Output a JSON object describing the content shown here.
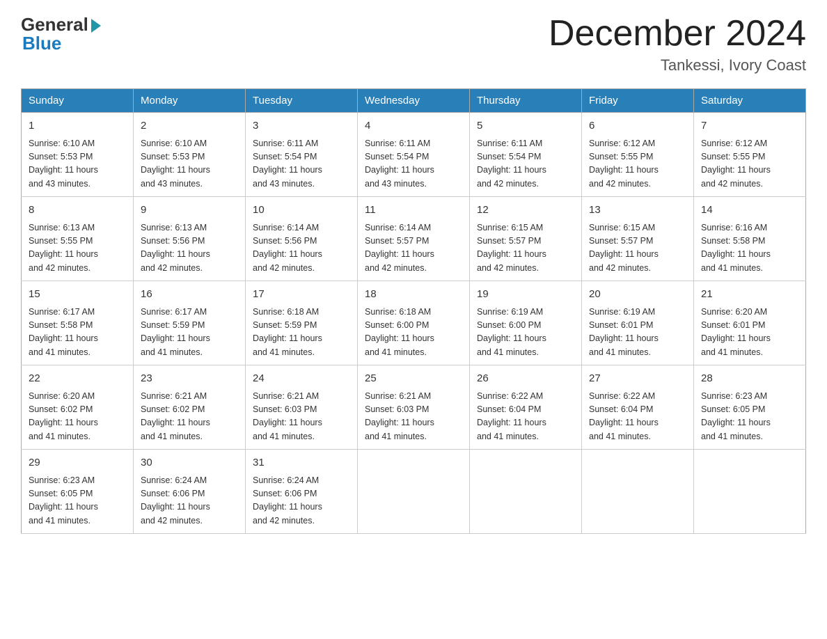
{
  "header": {
    "logo_general": "General",
    "logo_blue": "Blue",
    "month_title": "December 2024",
    "location": "Tankessi, Ivory Coast"
  },
  "days_of_week": [
    "Sunday",
    "Monday",
    "Tuesday",
    "Wednesday",
    "Thursday",
    "Friday",
    "Saturday"
  ],
  "weeks": [
    [
      {
        "day": "1",
        "sunrise": "6:10 AM",
        "sunset": "5:53 PM",
        "daylight": "11 hours and 43 minutes."
      },
      {
        "day": "2",
        "sunrise": "6:10 AM",
        "sunset": "5:53 PM",
        "daylight": "11 hours and 43 minutes."
      },
      {
        "day": "3",
        "sunrise": "6:11 AM",
        "sunset": "5:54 PM",
        "daylight": "11 hours and 43 minutes."
      },
      {
        "day": "4",
        "sunrise": "6:11 AM",
        "sunset": "5:54 PM",
        "daylight": "11 hours and 43 minutes."
      },
      {
        "day": "5",
        "sunrise": "6:11 AM",
        "sunset": "5:54 PM",
        "daylight": "11 hours and 42 minutes."
      },
      {
        "day": "6",
        "sunrise": "6:12 AM",
        "sunset": "5:55 PM",
        "daylight": "11 hours and 42 minutes."
      },
      {
        "day": "7",
        "sunrise": "6:12 AM",
        "sunset": "5:55 PM",
        "daylight": "11 hours and 42 minutes."
      }
    ],
    [
      {
        "day": "8",
        "sunrise": "6:13 AM",
        "sunset": "5:55 PM",
        "daylight": "11 hours and 42 minutes."
      },
      {
        "day": "9",
        "sunrise": "6:13 AM",
        "sunset": "5:56 PM",
        "daylight": "11 hours and 42 minutes."
      },
      {
        "day": "10",
        "sunrise": "6:14 AM",
        "sunset": "5:56 PM",
        "daylight": "11 hours and 42 minutes."
      },
      {
        "day": "11",
        "sunrise": "6:14 AM",
        "sunset": "5:57 PM",
        "daylight": "11 hours and 42 minutes."
      },
      {
        "day": "12",
        "sunrise": "6:15 AM",
        "sunset": "5:57 PM",
        "daylight": "11 hours and 42 minutes."
      },
      {
        "day": "13",
        "sunrise": "6:15 AM",
        "sunset": "5:57 PM",
        "daylight": "11 hours and 42 minutes."
      },
      {
        "day": "14",
        "sunrise": "6:16 AM",
        "sunset": "5:58 PM",
        "daylight": "11 hours and 41 minutes."
      }
    ],
    [
      {
        "day": "15",
        "sunrise": "6:17 AM",
        "sunset": "5:58 PM",
        "daylight": "11 hours and 41 minutes."
      },
      {
        "day": "16",
        "sunrise": "6:17 AM",
        "sunset": "5:59 PM",
        "daylight": "11 hours and 41 minutes."
      },
      {
        "day": "17",
        "sunrise": "6:18 AM",
        "sunset": "5:59 PM",
        "daylight": "11 hours and 41 minutes."
      },
      {
        "day": "18",
        "sunrise": "6:18 AM",
        "sunset": "6:00 PM",
        "daylight": "11 hours and 41 minutes."
      },
      {
        "day": "19",
        "sunrise": "6:19 AM",
        "sunset": "6:00 PM",
        "daylight": "11 hours and 41 minutes."
      },
      {
        "day": "20",
        "sunrise": "6:19 AM",
        "sunset": "6:01 PM",
        "daylight": "11 hours and 41 minutes."
      },
      {
        "day": "21",
        "sunrise": "6:20 AM",
        "sunset": "6:01 PM",
        "daylight": "11 hours and 41 minutes."
      }
    ],
    [
      {
        "day": "22",
        "sunrise": "6:20 AM",
        "sunset": "6:02 PM",
        "daylight": "11 hours and 41 minutes."
      },
      {
        "day": "23",
        "sunrise": "6:21 AM",
        "sunset": "6:02 PM",
        "daylight": "11 hours and 41 minutes."
      },
      {
        "day": "24",
        "sunrise": "6:21 AM",
        "sunset": "6:03 PM",
        "daylight": "11 hours and 41 minutes."
      },
      {
        "day": "25",
        "sunrise": "6:21 AM",
        "sunset": "6:03 PM",
        "daylight": "11 hours and 41 minutes."
      },
      {
        "day": "26",
        "sunrise": "6:22 AM",
        "sunset": "6:04 PM",
        "daylight": "11 hours and 41 minutes."
      },
      {
        "day": "27",
        "sunrise": "6:22 AM",
        "sunset": "6:04 PM",
        "daylight": "11 hours and 41 minutes."
      },
      {
        "day": "28",
        "sunrise": "6:23 AM",
        "sunset": "6:05 PM",
        "daylight": "11 hours and 41 minutes."
      }
    ],
    [
      {
        "day": "29",
        "sunrise": "6:23 AM",
        "sunset": "6:05 PM",
        "daylight": "11 hours and 41 minutes."
      },
      {
        "day": "30",
        "sunrise": "6:24 AM",
        "sunset": "6:06 PM",
        "daylight": "11 hours and 42 minutes."
      },
      {
        "day": "31",
        "sunrise": "6:24 AM",
        "sunset": "6:06 PM",
        "daylight": "11 hours and 42 minutes."
      },
      null,
      null,
      null,
      null
    ]
  ],
  "labels": {
    "sunrise": "Sunrise:",
    "sunset": "Sunset:",
    "daylight": "Daylight:"
  }
}
